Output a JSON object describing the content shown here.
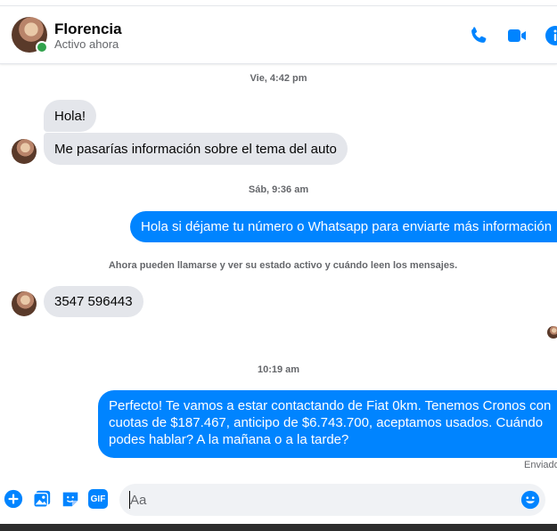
{
  "header": {
    "name": "Florencia",
    "status": "Activo ahora",
    "icons": [
      "phone-icon",
      "video-camera-icon",
      "info-icon"
    ]
  },
  "conversation": {
    "timestamps": [
      "Vie, 4:42 pm",
      "Sáb, 9:36 am",
      "10:19 am"
    ],
    "messages": [
      {
        "from": "contact",
        "text": "Hola!"
      },
      {
        "from": "contact",
        "text": "Me pasarías información sobre el tema del auto"
      },
      {
        "from": "me",
        "text": "Hola si déjame tu número o Whatsapp para enviarte más información"
      },
      {
        "from": "contact",
        "text": "3547 596443"
      },
      {
        "from": "me",
        "text": "Perfecto! Te vamos a estar contactando de Fiat 0km. Tenemos Cronos con cuotas de $187.467, anticipo de $6.743.700, aceptamos usados. Cuándo podes hablar? A la mañana o a la tarde?"
      }
    ],
    "system_notice": "Ahora pueden llamarse y ver su estado activo y cuándo leen los mensajes.",
    "sent_status": "Enviado"
  },
  "composer": {
    "placeholder": "Aa",
    "icons": [
      "plus-icon",
      "photo-icon",
      "sticker-icon",
      "gif-icon",
      "emoji-icon"
    ],
    "gif_label": "GIF"
  },
  "colors": {
    "accent": "#0084ff",
    "incoming_bubble": "#e4e6eb",
    "online": "#31a24c",
    "muted_text": "#65676b"
  }
}
